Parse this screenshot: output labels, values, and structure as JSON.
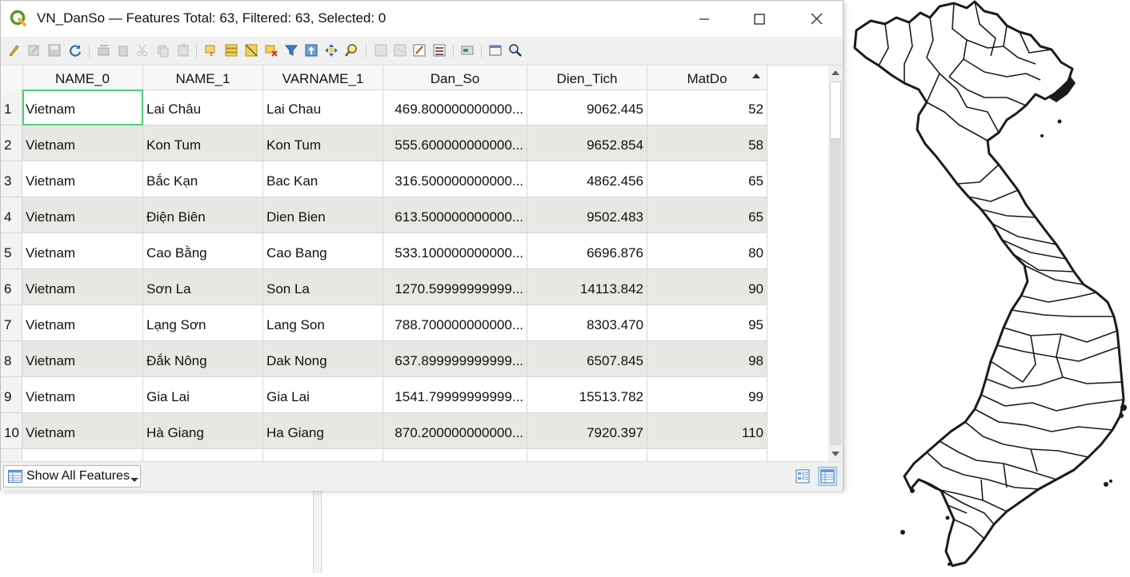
{
  "window": {
    "title": "VN_DanSo — Features Total: 63, Filtered: 63, Selected: 0",
    "controls": {
      "minimize": "—",
      "maximize": "☐",
      "close": "✕"
    }
  },
  "toolbar": {
    "icons": [
      "toggle-editing-icon",
      "multi-edit-icon",
      "save-edits-icon",
      "reload-icon",
      "add-feature-icon",
      "delete-feature-icon",
      "cut-icon",
      "copy-icon",
      "paste-icon",
      "select-by-expression-icon",
      "select-all-icon",
      "invert-selection-icon",
      "deselect-all-icon",
      "filter-select-icon",
      "move-selection-to-top-icon",
      "pan-to-selection-icon",
      "zoom-to-selection-icon",
      "new-field-icon",
      "delete-field-icon",
      "field-calculator-icon",
      "conditional-formatting-icon",
      "actions-icon",
      "dock-icon",
      "zoom-map-icon"
    ]
  },
  "table": {
    "columns": [
      "NAME_0",
      "NAME_1",
      "VARNAME_1",
      "Dan_So",
      "Dien_Tich",
      "MatDo"
    ],
    "sort": {
      "column": "MatDo",
      "direction": "ascending"
    },
    "rows": [
      {
        "n": "1",
        "cells": [
          "Vietnam",
          "Lai Châu",
          "Lai Chau",
          "469.800000000000...",
          "9062.445",
          "52"
        ]
      },
      {
        "n": "2",
        "cells": [
          "Vietnam",
          "Kon Tum",
          "Kon Tum",
          "555.600000000000...",
          "9652.854",
          "58"
        ]
      },
      {
        "n": "3",
        "cells": [
          "Vietnam",
          "Bắc Kạn",
          "Bac Kan",
          "316.500000000000...",
          "4862.456",
          "65"
        ]
      },
      {
        "n": "4",
        "cells": [
          "Vietnam",
          "Điện Biên",
          "Dien Bien",
          "613.500000000000...",
          "9502.483",
          "65"
        ]
      },
      {
        "n": "5",
        "cells": [
          "Vietnam",
          "Cao Bằng",
          "Cao Bang",
          "533.100000000000...",
          "6696.876",
          "80"
        ]
      },
      {
        "n": "6",
        "cells": [
          "Vietnam",
          "Sơn La",
          "Son La",
          "1270.59999999999...",
          "14113.842",
          "90"
        ]
      },
      {
        "n": "7",
        "cells": [
          "Vietnam",
          "Lạng Sơn",
          "Lang Son",
          "788.700000000000...",
          "8303.470",
          "95"
        ]
      },
      {
        "n": "8",
        "cells": [
          "Vietnam",
          "Đắk Nông",
          "Dak Nong",
          "637.899999999999...",
          "6507.845",
          "98"
        ]
      },
      {
        "n": "9",
        "cells": [
          "Vietnam",
          "Gia Lai",
          "Gia Lai",
          "1541.79999999999...",
          "15513.782",
          "99"
        ]
      },
      {
        "n": "10",
        "cells": [
          "Vietnam",
          "Hà Giang",
          "Ha Giang",
          "870.200000000000...",
          "7920.397",
          "110"
        ]
      }
    ]
  },
  "bottombar": {
    "show_features_label": "Show All Features",
    "view_modes": [
      "form-view-icon",
      "table-view-icon"
    ]
  },
  "colors": {
    "row_alt": "#e9e7e3",
    "focus_outline": "#4fd07a",
    "map_stroke": "#1b1b1b"
  }
}
